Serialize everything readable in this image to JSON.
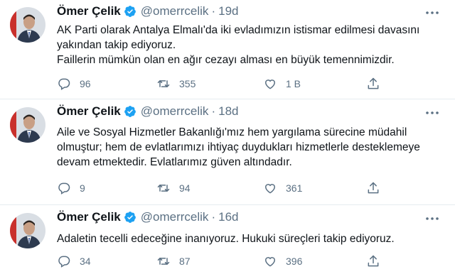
{
  "tweets": [
    {
      "author_name": "Ömer Çelik",
      "author_handle": "@omerrcelik",
      "time": "19d",
      "lines": [
        "AK Parti olarak Antalya Elmalı'da iki evladımızın istismar edilmesi davasını",
        "yakından takip ediyoruz.",
        "Faillerin mümkün olan en ağır cezayı alması en büyük temennimizdir."
      ],
      "replies": "96",
      "retweets": "355",
      "likes": "1 B"
    },
    {
      "author_name": "Ömer Çelik",
      "author_handle": "@omerrcelik",
      "time": "18d",
      "lines": [
        "Aile ve Sosyal Hizmetler Bakanlığı'mız hem yargılama sürecine müdahil",
        "olmuştur; hem de evlatlarımızı ihtiyaç duydukları hizmetlerle desteklemeye",
        "devam etmektedir. Evlatlarımız güven altındadır."
      ],
      "replies": "9",
      "retweets": "94",
      "likes": "361"
    },
    {
      "author_name": "Ömer Çelik",
      "author_handle": "@omerrcelik",
      "time": "16d",
      "lines": [
        "Adaletin tecelli edeceğine inanıyoruz. Hukuki süreçleri takip ediyoruz."
      ],
      "replies": "34",
      "retweets": "87",
      "likes": "396"
    }
  ],
  "separator": "·",
  "colors": {
    "verified_blue": "#1da1f2",
    "secondary_text": "#5b7083",
    "primary_text": "#0f1419"
  },
  "icons": [
    "verified-badge-icon",
    "more-options-icon",
    "reply-icon",
    "retweet-icon",
    "like-icon",
    "share-icon"
  ]
}
